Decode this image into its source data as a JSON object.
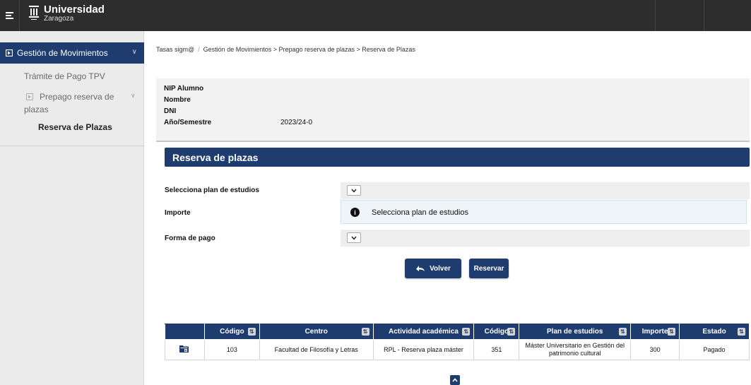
{
  "header": {
    "logo_title": "Universidad",
    "logo_subtitle": "Zaragoza"
  },
  "sidebar": {
    "active_section": "Gestión de Movimientos",
    "items": [
      {
        "label": "Trámite de Pago TPV"
      },
      {
        "label": "Prepago reserva de"
      },
      {
        "label": "plazas"
      }
    ],
    "sub_item": "Reserva de Plazas"
  },
  "breadcrumb": {
    "root": "Tasas sigm@",
    "path": "Gestión de Movimientos > Prepago reserva de plazas > Reserva de Plazas"
  },
  "student_info": {
    "nip_label": "NIP Alumno",
    "nombre_label": "Nombre",
    "dni_label": "DNI",
    "year_label": "Año/Semestre",
    "year_value": "2023/24-0"
  },
  "section": {
    "title": "Reserva de plazas"
  },
  "form": {
    "plan_label": "Selecciona plan de estudios",
    "importe_label": "Importe",
    "importe_message": "Selecciona plan de estudios",
    "pago_label": "Forma de pago"
  },
  "buttons": {
    "back": "Volver",
    "reserve": "Reservar"
  },
  "table": {
    "headers": [
      "",
      "Código",
      "Centro",
      "Actividad académica",
      "Código",
      "Plan de estudios",
      "Importe",
      "Estado"
    ],
    "rows": [
      {
        "codigo": "103",
        "centro": "Facultad de Filosofía y Letras",
        "actividad": "RPL - Reserva plaza máster",
        "codigo_plan": "351",
        "plan_line1": "Máster Universitario en Gestión del",
        "plan_line2": "patrimonio cultural",
        "importe": "300",
        "estado": "Pagado"
      }
    ]
  },
  "colors": {
    "primary": "#1f3c6e",
    "topbar": "#2d2d2d",
    "sidebar_bg": "#ebebeb"
  }
}
